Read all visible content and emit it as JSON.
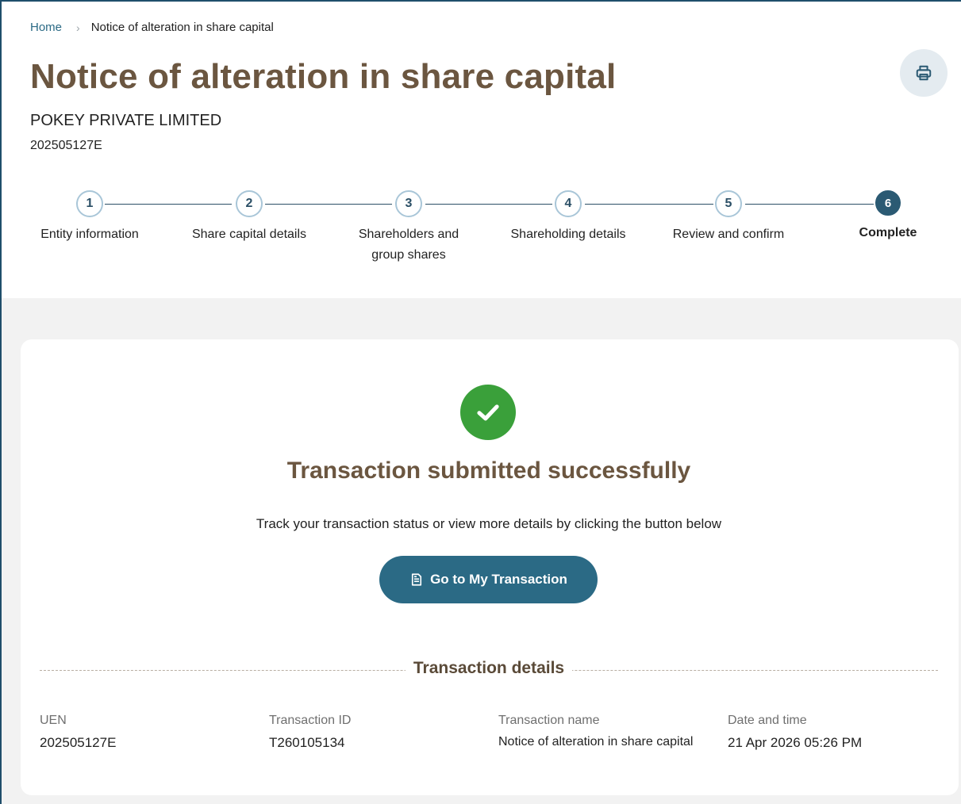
{
  "breadcrumb": {
    "home": "Home",
    "current": "Notice of alteration in share capital"
  },
  "page": {
    "title": "Notice of alteration in share capital",
    "company_name": "POKEY PRIVATE LIMITED",
    "company_uen": "202505127E",
    "print_icon": "printer-icon"
  },
  "stepper": {
    "current_step": 6,
    "steps": [
      {
        "number": "1",
        "label": "Entity information"
      },
      {
        "number": "2",
        "label": "Share capital details"
      },
      {
        "number": "3",
        "label": "Shareholders and group shares"
      },
      {
        "number": "4",
        "label": "Shareholding details"
      },
      {
        "number": "5",
        "label": "Review and confirm"
      },
      {
        "number": "6",
        "label": "Complete"
      }
    ]
  },
  "result": {
    "icon": "check-circle-icon",
    "title": "Transaction submitted successfully",
    "message": "Track your transaction status or view more details by clicking the button below",
    "button_label": "Go to My Transaction",
    "button_icon": "document-icon"
  },
  "details": {
    "heading": "Transaction details",
    "fields": [
      {
        "label": "UEN",
        "value": "202505127E"
      },
      {
        "label": "Transaction ID",
        "value": "T260105134"
      },
      {
        "label": "Transaction name",
        "value": "Notice of alteration in share capital"
      },
      {
        "label": "Date and time",
        "value": "21 Apr 2026 05:26 PM"
      }
    ]
  },
  "colors": {
    "title_brown": "#6b5640",
    "primary_teal": "#2b6a85",
    "success_green": "#3aa03a",
    "page_gray": "#f2f2f2"
  }
}
